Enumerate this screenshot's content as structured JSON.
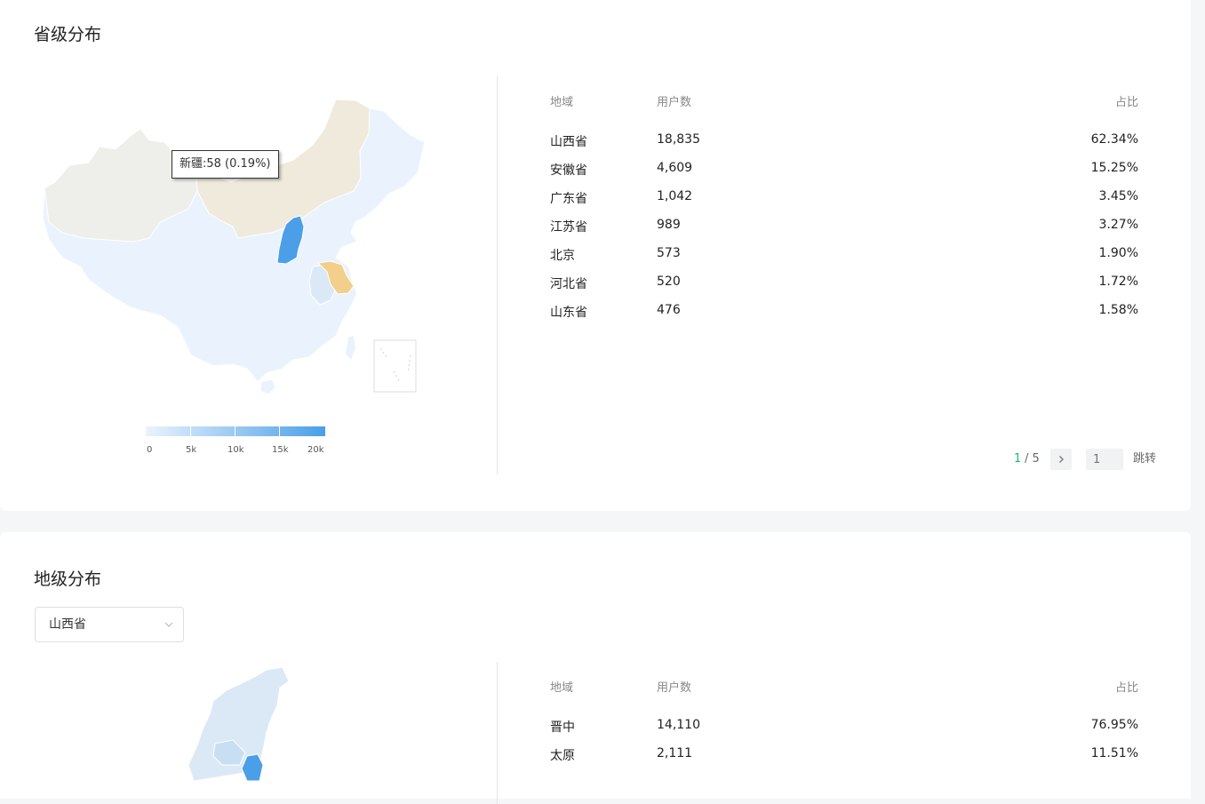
{
  "province_section": {
    "title": "省级分布",
    "tooltip": "新疆:58 (0.19%)",
    "legend": {
      "ticks": [
        "0",
        "5k",
        "10k",
        "15k",
        "20k"
      ],
      "min": 0,
      "max": 20000
    },
    "table": {
      "headers": {
        "region": "地域",
        "users": "用户数",
        "ratio": "占比"
      },
      "rows": [
        {
          "region": "山西省",
          "users": "18,835",
          "ratio": "62.34%"
        },
        {
          "region": "安徽省",
          "users": "4,609",
          "ratio": "15.25%"
        },
        {
          "region": "广东省",
          "users": "1,042",
          "ratio": "3.45%"
        },
        {
          "region": "江苏省",
          "users": "989",
          "ratio": "3.27%"
        },
        {
          "region": "北京",
          "users": "573",
          "ratio": "1.90%"
        },
        {
          "region": "河北省",
          "users": "520",
          "ratio": "1.72%"
        },
        {
          "region": "山东省",
          "users": "476",
          "ratio": "1.58%"
        }
      ]
    },
    "pagination": {
      "current": "1",
      "total": "/ 5",
      "jump_placeholder": "1",
      "jump_label": "跳转"
    },
    "colors": {
      "shanxi": "#4a9fe8",
      "jiangsu": "#f2cf8a",
      "anhui": "#dbe9f7",
      "default": "#eaf3fd",
      "no_data_west": "#eeeeea",
      "no_data_north": "#efeadb"
    }
  },
  "city_section": {
    "title": "地级分布",
    "select": {
      "value": "山西省"
    },
    "table": {
      "headers": {
        "region": "地域",
        "users": "用户数",
        "ratio": "占比"
      },
      "rows": [
        {
          "region": "晋中",
          "users": "14,110",
          "ratio": "76.95%"
        },
        {
          "region": "太原",
          "users": "2,111",
          "ratio": "11.51%"
        }
      ]
    }
  }
}
